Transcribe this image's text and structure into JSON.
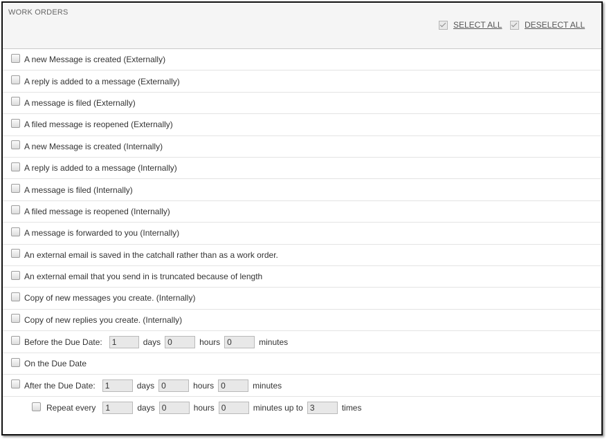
{
  "header": {
    "title": "WORK ORDERS",
    "select_all": "SELECT ALL",
    "deselect_all": "DESELECT ALL"
  },
  "notifications": [
    "A new Message is created (Externally)",
    "A reply is added to a message (Externally)",
    "A message is filed (Externally)",
    "A filed message is reopened (Externally)",
    "A new Message is created (Internally)",
    "A reply is added to a message (Internally)",
    "A message is filed (Internally)",
    "A filed message is reopened (Internally)",
    "A message is forwarded to you (Internally)",
    "An external email is saved in the catchall rather than as a work order.",
    "An external email that you send in is truncated because of length",
    "Copy of new messages you create. (Internally)",
    "Copy of new replies you create. (Internally)"
  ],
  "before_due": {
    "label": "Before the Due Date:",
    "days": "1",
    "hours": "0",
    "minutes": "0"
  },
  "on_due": {
    "label": "On the Due Date"
  },
  "after_due": {
    "label": "After the Due Date:",
    "days": "1",
    "hours": "0",
    "minutes": "0"
  },
  "repeat": {
    "label": "Repeat every",
    "days": "1",
    "hours": "0",
    "minutes": "0",
    "times": "3"
  },
  "units": {
    "days": "days",
    "hours": "hours",
    "minutes": "minutes",
    "minutes_up_to": "minutes up to",
    "times": "times"
  }
}
